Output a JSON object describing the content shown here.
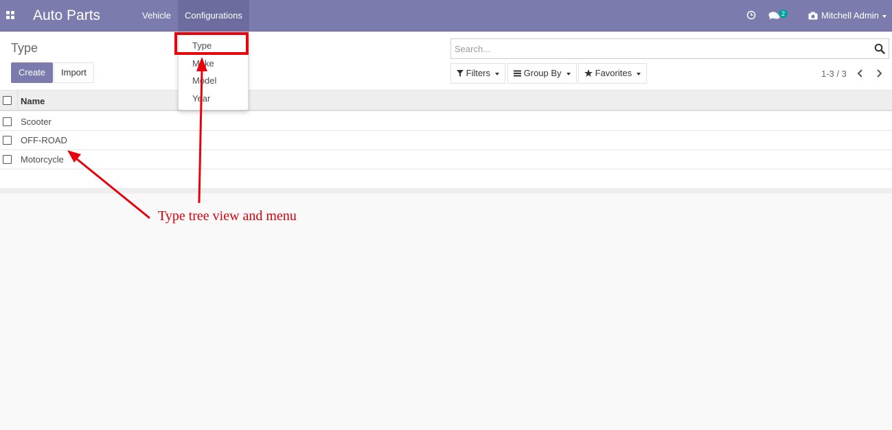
{
  "navbar": {
    "app_title": "Auto Parts",
    "menu": [
      {
        "label": "Vehicle"
      },
      {
        "label": "Configurations",
        "active": true
      }
    ],
    "messages_count": "2",
    "user_name": "Mitchell Admin"
  },
  "dropdown": {
    "items": [
      {
        "label": "Type"
      },
      {
        "label": "Make"
      },
      {
        "label": "Model"
      },
      {
        "label": "Year"
      }
    ]
  },
  "control_panel": {
    "breadcrumb": "Type",
    "create_label": "Create",
    "import_label": "Import",
    "search_placeholder": "Search...",
    "filters_label": "Filters",
    "groupby_label": "Group By",
    "favorites_label": "Favorites",
    "pager": "1-3 / 3"
  },
  "list": {
    "column_name": "Name",
    "rows": [
      {
        "name": "Scooter"
      },
      {
        "name": "OFF-ROAD"
      },
      {
        "name": "Motorcycle"
      }
    ]
  },
  "annotation": {
    "text": "Type tree view and menu"
  },
  "colors": {
    "navbar": "#7c7bad",
    "annotation": "#e8000b",
    "badge": "#00a09d"
  },
  "icons": [
    "apps-icon",
    "clock-icon",
    "chat-icon",
    "camera-icon",
    "search-icon",
    "filter-icon",
    "list-icon",
    "star-icon",
    "chevron-left-icon",
    "chevron-right-icon"
  ]
}
